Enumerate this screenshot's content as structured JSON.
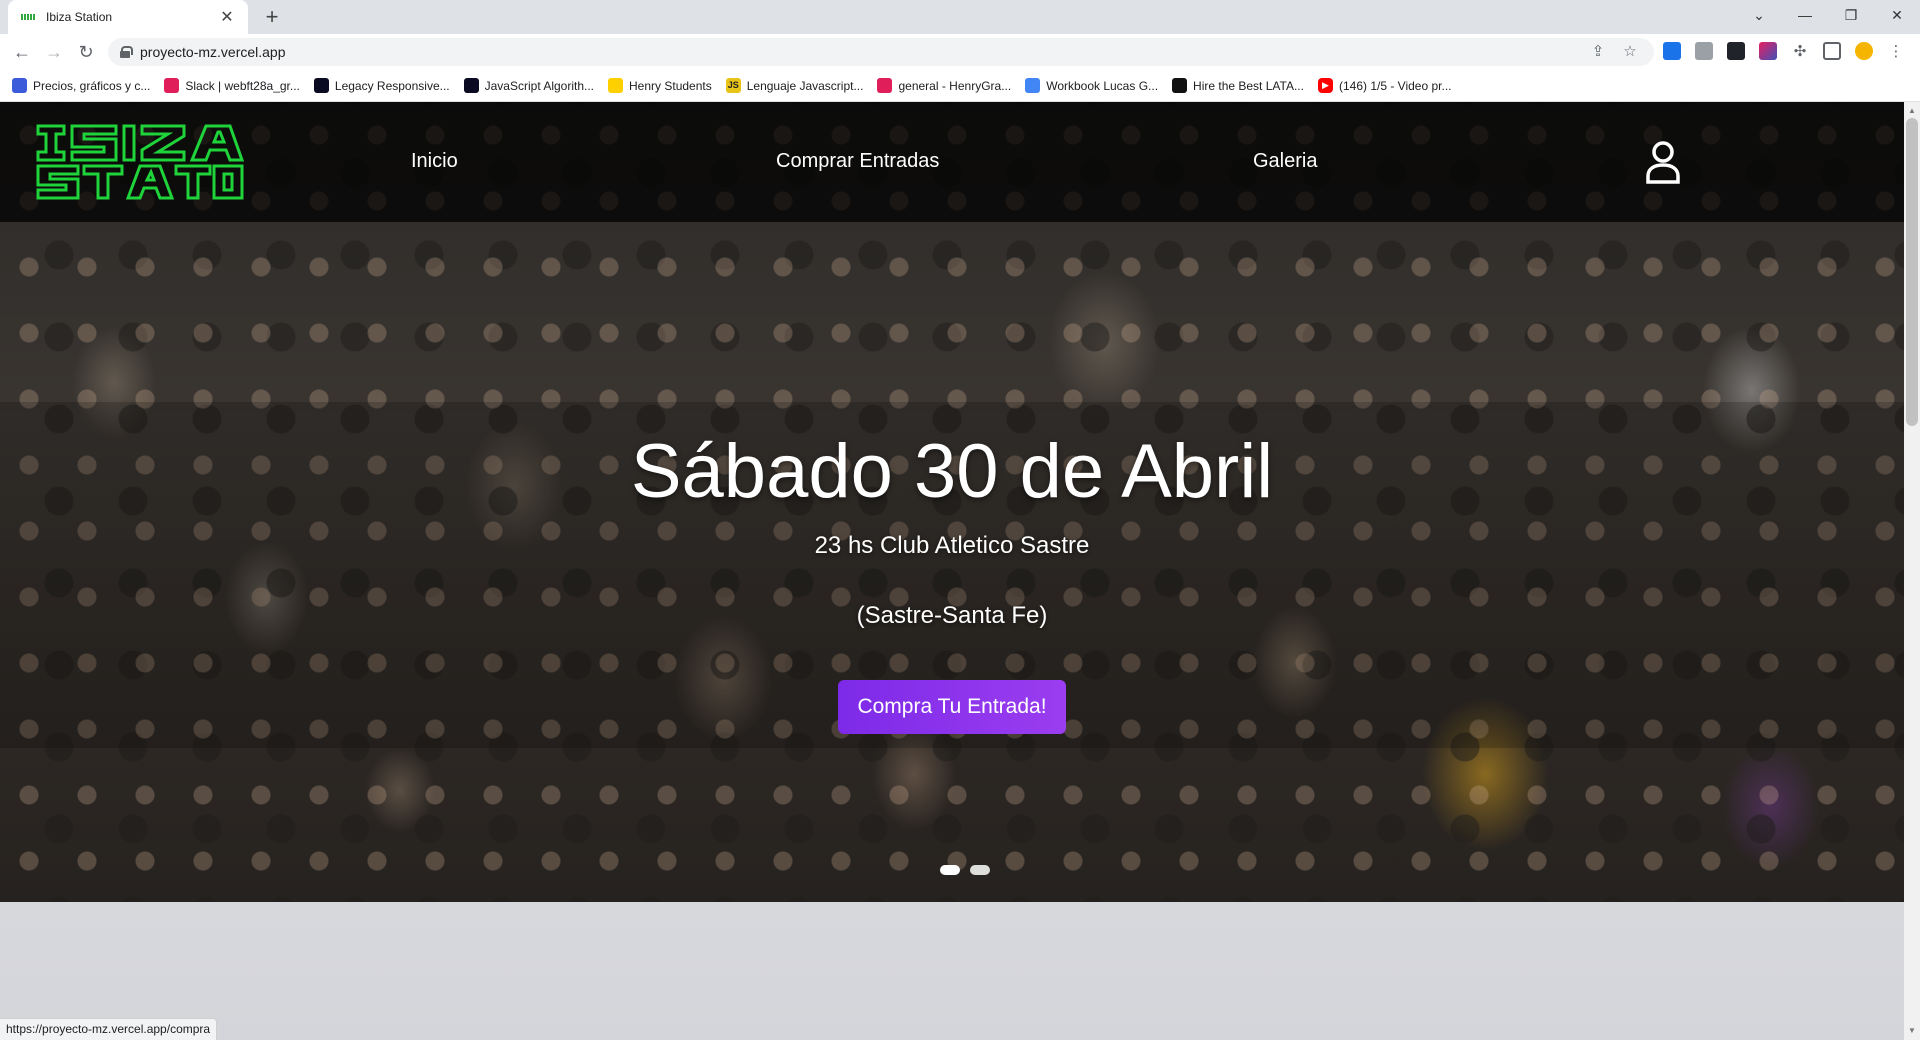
{
  "browser": {
    "tab_title": "Ibiza Station",
    "url": "proyecto-mz.vercel.app",
    "status_url": "https://proyecto-mz.vercel.app/compra",
    "bookmarks": [
      {
        "label": "Precios, gráficos y c...",
        "icon": "coin-icon",
        "color": "#3b5bdb"
      },
      {
        "label": "Slack | webft28a_gr...",
        "icon": "slack-icon",
        "color": "#e01e5a"
      },
      {
        "label": "Legacy Responsive...",
        "icon": "fcc-icon",
        "color": "#0a0a23"
      },
      {
        "label": "JavaScript Algorith...",
        "icon": "fcc-icon",
        "color": "#0a0a23"
      },
      {
        "label": "Henry Students",
        "icon": "henry-icon",
        "color": "#ffd000"
      },
      {
        "label": "Lenguaje Javascript...",
        "icon": "js-icon",
        "color": "#e8c419"
      },
      {
        "label": "general - HenryGra...",
        "icon": "slack-icon",
        "color": "#e01e5a"
      },
      {
        "label": "Workbook Lucas G...",
        "icon": "docs-icon",
        "color": "#4285f4"
      },
      {
        "label": "Hire the Best LATA...",
        "icon": "henry-icon",
        "color": "#111111"
      },
      {
        "label": "(146) 1/5 - Video pr...",
        "icon": "youtube-icon",
        "color": "#ff0000"
      }
    ]
  },
  "site": {
    "nav": {
      "inicio": "Inicio",
      "comprar": "Comprar Entradas",
      "galeria": "Galeria"
    },
    "hero": {
      "title": "Sábado 30 de Abril",
      "subtitle": "23 hs Club Atletico Sastre",
      "location": "(Sastre-Santa Fe)",
      "cta": "Compra Tu Entrada!"
    },
    "colors": {
      "logo_green": "#1fd33a",
      "cta_purple": "#8a33ec"
    }
  }
}
